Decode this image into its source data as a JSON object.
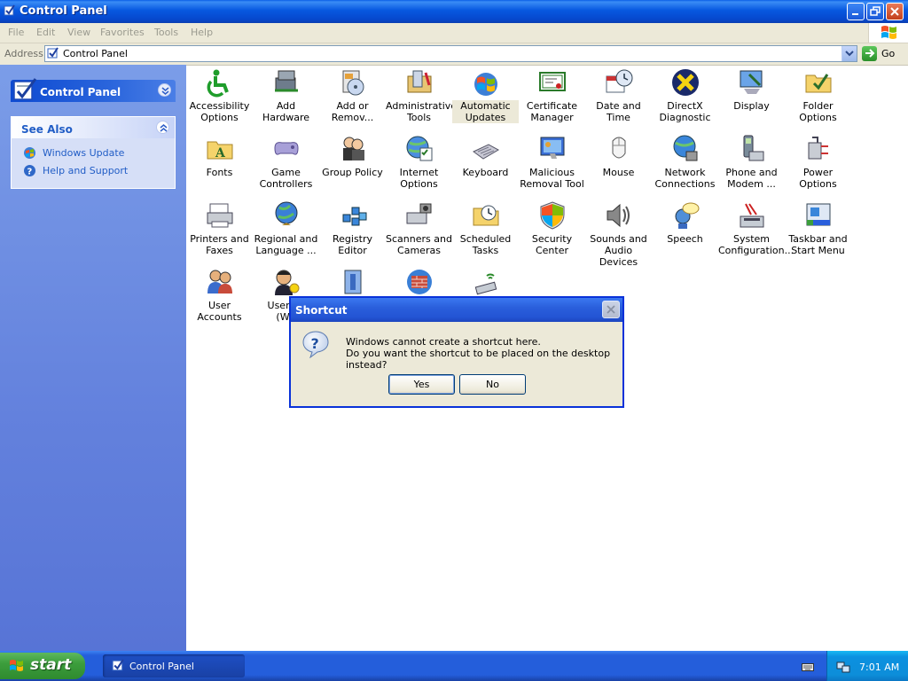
{
  "window": {
    "title": "Control Panel"
  },
  "menu": [
    "File",
    "Edit",
    "View",
    "Favorites",
    "Tools",
    "Help"
  ],
  "address": {
    "label": "Address",
    "value": "Control Panel",
    "go_label": "Go"
  },
  "sidebar": {
    "panel_title": "Control Panel",
    "see_also": {
      "title": "See Also",
      "links": [
        "Windows Update",
        "Help and Support"
      ]
    }
  },
  "items": [
    {
      "label": "Accessibility\nOptions",
      "icon": "accessibility-icon"
    },
    {
      "label": "Add Hardware",
      "icon": "add-hardware-icon"
    },
    {
      "label": "Add or\nRemov...",
      "icon": "add-remove-programs-icon"
    },
    {
      "label": "Administrative\nTools",
      "icon": "administrative-tools-icon"
    },
    {
      "label": "Automatic\nUpdates",
      "icon": "automatic-updates-icon"
    },
    {
      "label": "Certificate\nManager",
      "icon": "certificate-manager-icon"
    },
    {
      "label": "Date and Time",
      "icon": "date-time-icon"
    },
    {
      "label": "DirectX\nDiagnostic",
      "icon": "directx-icon"
    },
    {
      "label": "Display",
      "icon": "display-icon"
    },
    {
      "label": "Folder Options",
      "icon": "folder-options-icon"
    },
    {
      "label": "Fonts",
      "icon": "fonts-icon"
    },
    {
      "label": "Game\nControllers",
      "icon": "game-controllers-icon"
    },
    {
      "label": "Group Policy",
      "icon": "group-policy-icon"
    },
    {
      "label": "Internet\nOptions",
      "icon": "internet-options-icon"
    },
    {
      "label": "Keyboard",
      "icon": "keyboard-icon"
    },
    {
      "label": "Malicious\nRemoval Tool",
      "icon": "malicious-removal-icon"
    },
    {
      "label": "Mouse",
      "icon": "mouse-icon"
    },
    {
      "label": "Network\nConnections",
      "icon": "network-connections-icon"
    },
    {
      "label": "Phone and\nModem ...",
      "icon": "phone-modem-icon"
    },
    {
      "label": "Power Options",
      "icon": "power-options-icon"
    },
    {
      "label": "Printers and\nFaxes",
      "icon": "printers-icon"
    },
    {
      "label": "Regional and\nLanguage ...",
      "icon": "regional-icon"
    },
    {
      "label": "Registry Editor",
      "icon": "registry-editor-icon"
    },
    {
      "label": "Scanners and\nCameras",
      "icon": "scanners-icon"
    },
    {
      "label": "Scheduled\nTasks",
      "icon": "scheduled-tasks-icon"
    },
    {
      "label": "Security\nCenter",
      "icon": "security-center-icon"
    },
    {
      "label": "Sounds and\nAudio Devices",
      "icon": "sounds-icon"
    },
    {
      "label": "Speech",
      "icon": "speech-icon"
    },
    {
      "label": "System\nConfiguration...",
      "icon": "system-icon"
    },
    {
      "label": "Taskbar and\nStart Menu",
      "icon": "taskbar-icon"
    },
    {
      "label": "User Accounts",
      "icon": "user-accounts-icon"
    },
    {
      "label": "User Ac\n(W2",
      "icon": "user-accounts-w2-icon"
    },
    {
      "label": "",
      "icon": "book-icon"
    },
    {
      "label": "",
      "icon": "firewall-icon"
    },
    {
      "label": "",
      "icon": "wireless-icon"
    }
  ],
  "dialog": {
    "title": "Shortcut",
    "line1": "Windows cannot create a shortcut here.",
    "line2": "Do you want the shortcut to be placed on the desktop instead?",
    "yes": "Yes",
    "no": "No"
  },
  "taskbar": {
    "start_label": "start",
    "task_label": "Control Panel",
    "clock": "7:01 AM"
  }
}
